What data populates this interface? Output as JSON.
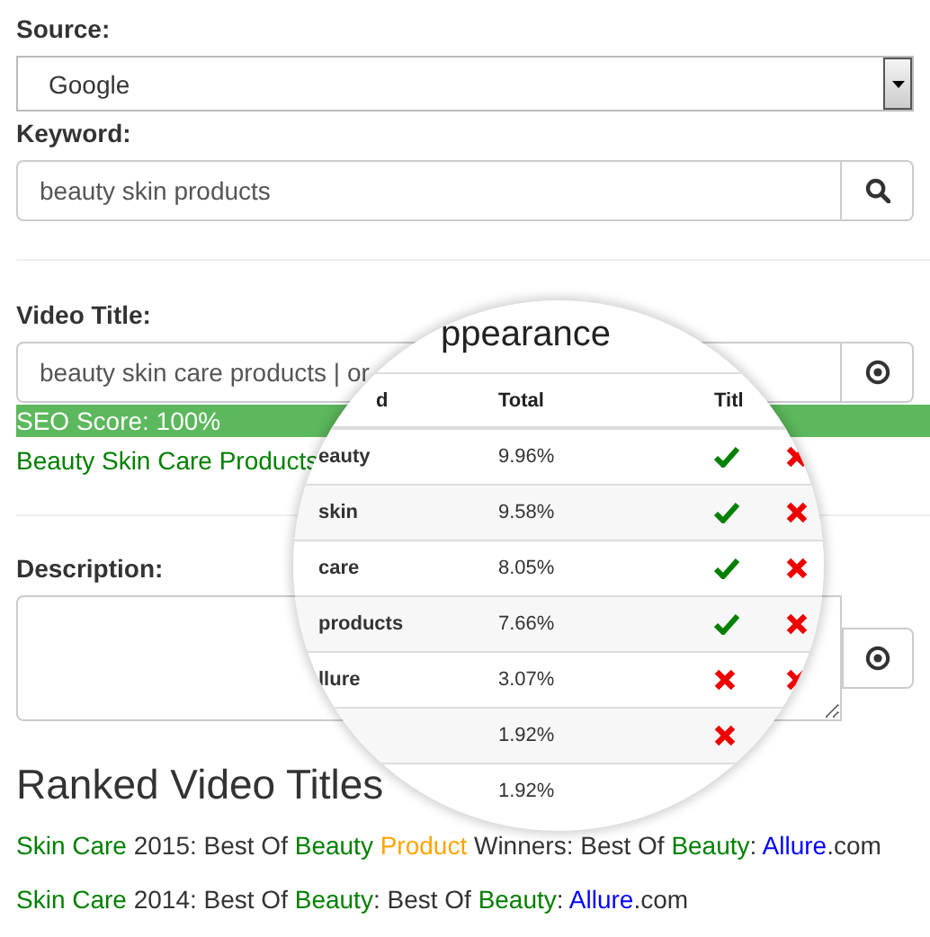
{
  "source": {
    "label": "Source:",
    "value": "Google"
  },
  "keyword": {
    "label": "Keyword:",
    "value": "beauty skin products"
  },
  "video_title": {
    "label": "Video Title:",
    "value": "beauty skin care products | or",
    "seo_score": "SEO Score: 100%",
    "suggestion": "Beauty Skin Care Products"
  },
  "description": {
    "label": "Description:"
  },
  "ranked": {
    "heading": "Ranked Video Titles",
    "titles": [
      {
        "segments": [
          {
            "text": "Skin Care",
            "color": "#008000"
          },
          {
            "text": " 2015: Best Of ",
            "color": "#333333"
          },
          {
            "text": "Beauty",
            "color": "#008000"
          },
          {
            "text": " Product",
            "color": "#ffa500"
          },
          {
            "text": " Winners: Best Of ",
            "color": "#333333"
          },
          {
            "text": "Beauty",
            "color": "#008000"
          },
          {
            "text": ": ",
            "color": "#333333"
          },
          {
            "text": "Allure",
            "color": "#0000ff"
          },
          {
            "text": ".com",
            "color": "#333333"
          }
        ]
      },
      {
        "segments": [
          {
            "text": "Skin Care",
            "color": "#008000"
          },
          {
            "text": " 2014: Best Of ",
            "color": "#333333"
          },
          {
            "text": "Beauty",
            "color": "#008000"
          },
          {
            "text": ": Best Of ",
            "color": "#333333"
          },
          {
            "text": "Beauty",
            "color": "#008000"
          },
          {
            "text": ": ",
            "color": "#333333"
          },
          {
            "text": "Allure",
            "color": "#0000ff"
          },
          {
            "text": ".com",
            "color": "#333333"
          }
        ]
      }
    ]
  },
  "magnifier": {
    "title": "ppearance",
    "columns": [
      "d",
      "Total",
      "Titl"
    ],
    "rows": [
      {
        "keyword": "eauty",
        "total": "9.96%",
        "title_ok": true,
        "col4_ok": false
      },
      {
        "keyword": "skin",
        "total": "9.58%",
        "title_ok": true,
        "col4_ok": false
      },
      {
        "keyword": "care",
        "total": "8.05%",
        "title_ok": true,
        "col4_ok": false
      },
      {
        "keyword": "products",
        "total": "7.66%",
        "title_ok": true,
        "col4_ok": false
      },
      {
        "keyword": "llure",
        "total": "3.07%",
        "title_ok": false,
        "col4_ok": false
      },
      {
        "total": "1.92%",
        "title_ok": false
      },
      {
        "total": "1.92%"
      }
    ]
  }
}
